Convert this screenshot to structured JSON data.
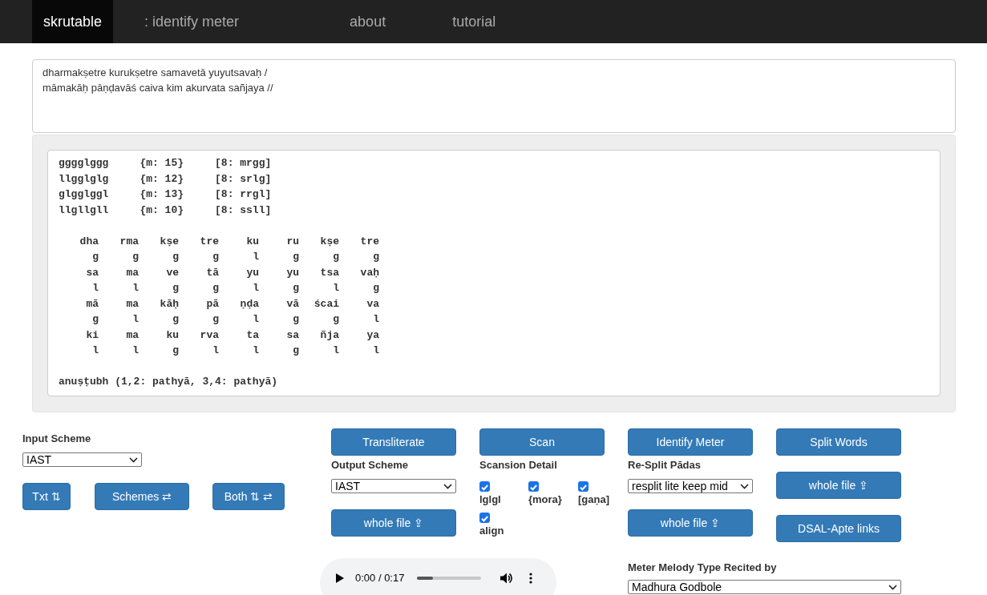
{
  "nav": [
    {
      "label": "skrutable",
      "selected": true
    },
    {
      "label": ": identify meter",
      "selected": false
    },
    {
      "label": "about",
      "selected": false
    },
    {
      "label": "tutorial",
      "selected": false
    }
  ],
  "input_text": [
    "dharmakṣetre kurukṣetre samavetā yuyutsavaḥ /",
    "māmakāḥ pāṇḍavāś caiva kim akurvata sañjaya //"
  ],
  "output": {
    "patterns": [
      "gggglggg     {m: 15}     [8: mrgg]",
      "llgglglg     {m: 12}     [8: srlg]",
      "glgglggl     {m: 13}     [8: rrgl]",
      "llgllgll     {m: 10}     [8: ssll]"
    ],
    "alignment": [
      {
        "syllables": [
          "dha",
          "rma",
          "kṣe",
          "tre",
          "ku",
          "ru",
          "kṣe",
          "tre"
        ],
        "weights": [
          "g",
          "g",
          "g",
          "g",
          "l",
          "g",
          "g",
          "g"
        ]
      },
      {
        "syllables": [
          "sa",
          "ma",
          "ve",
          "tā",
          "yu",
          "yu",
          "tsa",
          "vaḥ"
        ],
        "weights": [
          "l",
          "l",
          "g",
          "g",
          "l",
          "g",
          "l",
          "g"
        ]
      },
      {
        "syllables": [
          "mā",
          "ma",
          "kāḥ",
          "pā",
          "ṇḍa",
          "vā",
          "ścai",
          "va"
        ],
        "weights": [
          "g",
          "l",
          "g",
          "g",
          "l",
          "g",
          "g",
          "l"
        ]
      },
      {
        "syllables": [
          "ki",
          "ma",
          "ku",
          "rva",
          "ta",
          "sa",
          "ñja",
          "ya"
        ],
        "weights": [
          "l",
          "l",
          "g",
          "l",
          "l",
          "g",
          "l",
          "l"
        ]
      }
    ],
    "meter": "anuṣṭubh (1,2: pathyā, 3,4: pathyā)"
  },
  "input_scheme": {
    "label": "Input Scheme",
    "value": "IAST"
  },
  "swap_buttons": [
    "Txt ⇅",
    "Schemes ⇄",
    "Both ⇅ ⇄"
  ],
  "transliterate": {
    "button": "Transliterate",
    "label": "Output Scheme",
    "value": "IAST",
    "file_button": "whole file ⇪"
  },
  "scan": {
    "button": "Scan",
    "label": "Scansion Detail",
    "options": [
      {
        "label": "lglgl",
        "checked": true
      },
      {
        "label": "{mora}",
        "checked": true
      },
      {
        "label": "[gaṇa]",
        "checked": true
      },
      {
        "label": "align",
        "checked": true
      }
    ]
  },
  "identify": {
    "button": "Identify Meter",
    "label": "Re-Split Pādas",
    "value": "resplit lite keep mid",
    "file_button": "whole file ⇪"
  },
  "split": {
    "button": "Split Words",
    "file_button": "whole file ⇪",
    "links_button": "DSAL-Apte links"
  },
  "audio": {
    "time": "0:00 / 0:17",
    "level": 0.25
  },
  "melody": {
    "label": "Meter Melody Type Recited by",
    "value": "Madhura Godbole"
  }
}
